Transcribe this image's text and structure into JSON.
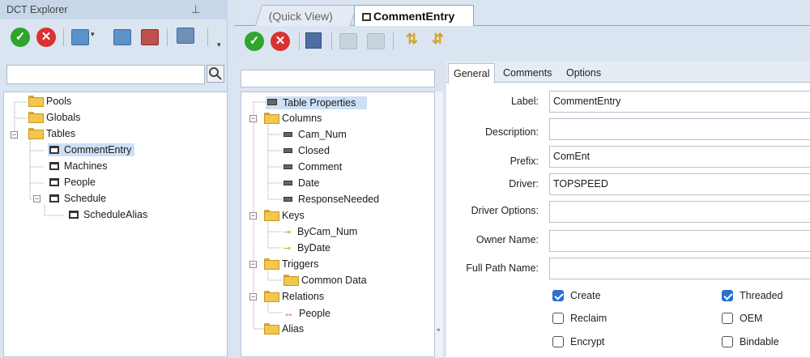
{
  "explorer": {
    "title": "DCT Explorer",
    "pin_icon": "pin-icon",
    "search_value": "",
    "tree": [
      {
        "label": "Pools",
        "icon": "folder-icon"
      },
      {
        "label": "Globals",
        "icon": "folder-icon"
      },
      {
        "label": "Tables",
        "icon": "folder-open-icon"
      },
      {
        "label": "CommentEntry",
        "icon": "table-icon"
      },
      {
        "label": "Machines",
        "icon": "table-icon"
      },
      {
        "label": "People",
        "icon": "table-icon"
      },
      {
        "label": "Schedule",
        "icon": "table-icon"
      },
      {
        "label": "ScheduleAlias",
        "icon": "table-icon"
      }
    ]
  },
  "doc_tabs": {
    "quick_view": "(Quick View)",
    "active": "CommentEntry"
  },
  "mid_tree": {
    "search_value": "",
    "items": [
      {
        "label": "Table Properties"
      },
      {
        "label": "Columns"
      },
      {
        "label": "Cam_Num"
      },
      {
        "label": "Closed"
      },
      {
        "label": "Comment"
      },
      {
        "label": "Date"
      },
      {
        "label": "ResponseNeeded"
      },
      {
        "label": "Keys"
      },
      {
        "label": "ByCam_Num"
      },
      {
        "label": "ByDate"
      },
      {
        "label": "Triggers"
      },
      {
        "label": "Common Data"
      },
      {
        "label": "Relations"
      },
      {
        "label": "People"
      },
      {
        "label": "Alias"
      }
    ]
  },
  "props": {
    "tabs": [
      "General",
      "Comments",
      "Options"
    ],
    "fields": {
      "label": {
        "label": "Label:",
        "value": "CommentEntry"
      },
      "description": {
        "label": "Description:",
        "value": ""
      },
      "prefix": {
        "label": "Prefix:",
        "value": "ComEnt"
      },
      "driver": {
        "label": "Driver:",
        "value": "TOPSPEED"
      },
      "driver_options": {
        "label": "Driver Options:",
        "value": ""
      },
      "owner_name": {
        "label": "Owner Name:",
        "value": ""
      },
      "full_path_name": {
        "label": "Full Path Name:",
        "value": ""
      }
    },
    "checks": [
      {
        "label": "Create",
        "checked": true
      },
      {
        "label": "Threaded",
        "checked": true
      },
      {
        "label": "Reclaim",
        "checked": false
      },
      {
        "label": "OEM",
        "checked": false
      },
      {
        "label": "Encrypt",
        "checked": false
      },
      {
        "label": "Bindable",
        "checked": false
      }
    ]
  },
  "colors": {
    "accent": "#2a6fd1",
    "ok": "#2fa52f",
    "cancel": "#d93232"
  }
}
